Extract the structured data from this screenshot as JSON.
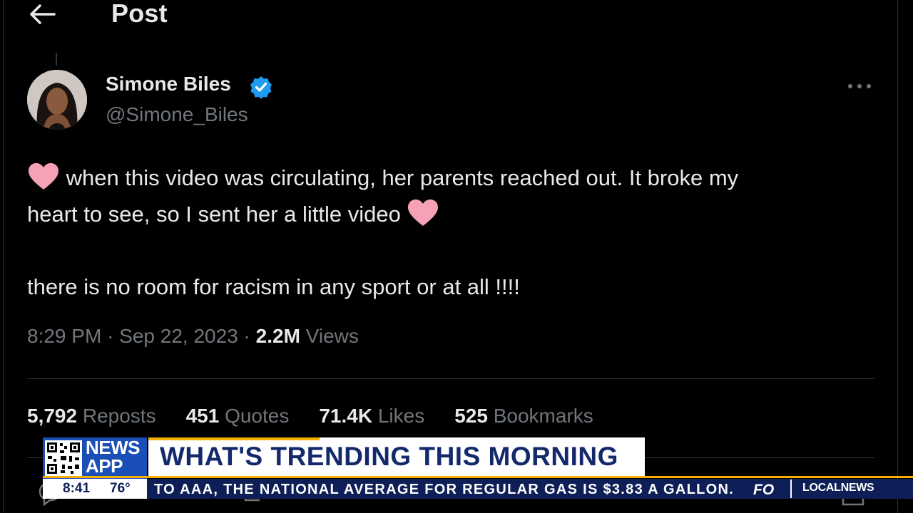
{
  "header": {
    "title": "Post"
  },
  "author": {
    "display_name": "Simone Biles",
    "handle": "@Simone_Biles",
    "verified": true
  },
  "tweet": {
    "line1": "when this video was circulating, her parents reached out. It broke my",
    "line2": "heart to see, so I sent her a little video",
    "line3": "there is no room for racism in any sport or at all !!!!"
  },
  "meta": {
    "time": "8:29 PM",
    "separator": "·",
    "date": "Sep 22, 2023",
    "views_count": "2.2M",
    "views_label": "Views"
  },
  "stats": [
    {
      "count": "5,792",
      "label": "Reposts"
    },
    {
      "count": "451",
      "label": "Quotes"
    },
    {
      "count": "71.4K",
      "label": "Likes"
    },
    {
      "count": "525",
      "label": "Bookmarks"
    }
  ],
  "overlay": {
    "news_line1": "NEWS",
    "news_line2": "APP",
    "headline": "WHAT'S TRENDING THIS MORNING",
    "clock_time": "8:41",
    "temperature": "76°",
    "ticker": "TO AAA, THE NATIONAL AVERAGE FOR REGULAR GAS IS $3.83 A GALLON.",
    "fox_mark": "FO",
    "local_news": "LOCALNEWS"
  },
  "colors": {
    "background": "#000000",
    "text_primary": "#e7e9ea",
    "text_secondary": "#71767b",
    "verified_blue": "#1d9bf0",
    "heart_pink": "#f7a1b6",
    "news_blue": "#1b4fb8",
    "headline_navy": "#13296b",
    "ticker_navy": "#0d1f56",
    "accent_gold": "#f5b000"
  },
  "icons": {
    "back": "arrow-left-icon",
    "verified": "verified-badge-icon",
    "more": "more-horizontal-icon",
    "heart": "pink-heart-emoji-icon",
    "reply": "reply-icon",
    "repost": "repost-icon",
    "like": "like-icon",
    "bookmark": "bookmark-icon",
    "share": "share-icon"
  }
}
